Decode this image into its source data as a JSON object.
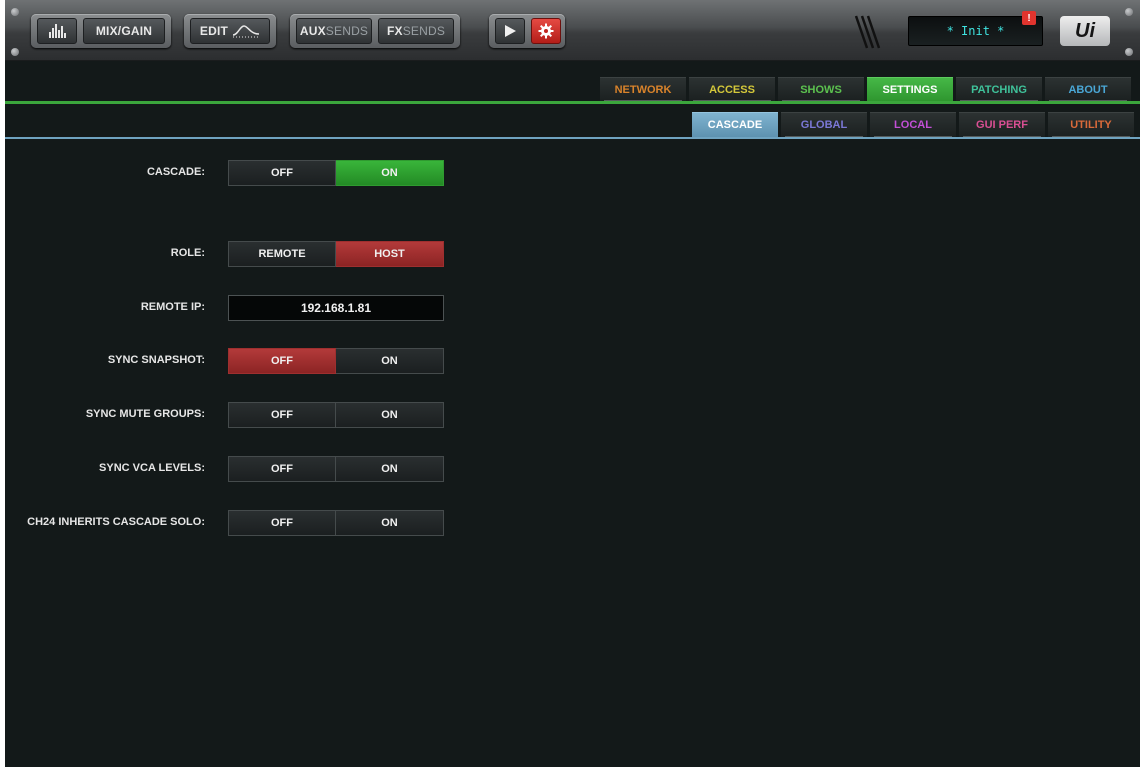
{
  "toolbar": {
    "mix_gain_label": "MIX/GAIN",
    "edit_label": "EDIT",
    "aux_prefix": "AUX",
    "aux_suffix": "SENDS",
    "fx_prefix": "FX",
    "fx_suffix": "SENDS",
    "display_text": "* Init *",
    "alert_badge": "!",
    "logo_text": "Ui",
    "icons": [
      "meters-icon",
      "eq-curve-icon",
      "play-icon",
      "gear-icon"
    ]
  },
  "main_tabs": [
    {
      "label": "NETWORK",
      "color": "#d9832b",
      "active": false
    },
    {
      "label": "ACCESS",
      "color": "#d4c83a",
      "active": false
    },
    {
      "label": "SHOWS",
      "color": "#5cc24f",
      "active": false
    },
    {
      "label": "SETTINGS",
      "color": "#ffffff",
      "bg": "#3ba63c",
      "active": true
    },
    {
      "label": "PATCHING",
      "color": "#3fc29a",
      "active": false
    },
    {
      "label": "ABOUT",
      "color": "#4aa7d6",
      "active": false
    }
  ],
  "sub_tabs": [
    {
      "label": "CASCADE",
      "color": "#ffffff",
      "bg": "#6fa3c0",
      "active": true
    },
    {
      "label": "GLOBAL",
      "color": "#7b78d6",
      "active": false
    },
    {
      "label": "LOCAL",
      "color": "#c24fd6",
      "active": false
    },
    {
      "label": "GUI PERF",
      "color": "#d94f93",
      "active": false
    },
    {
      "label": "UTILITY",
      "color": "#d96a3a",
      "active": false
    }
  ],
  "settings": {
    "cascade": {
      "label": "CASCADE:",
      "left": "OFF",
      "right": "ON",
      "selected": "right",
      "color": "green"
    },
    "role": {
      "label": "ROLE:",
      "left": "REMOTE",
      "right": "HOST",
      "selected": "right",
      "color": "red"
    },
    "remote_ip": {
      "label": "REMOTE IP:",
      "value": "192.168.1.81"
    },
    "sync_snapshot": {
      "label": "SYNC SNAPSHOT:",
      "left": "OFF",
      "right": "ON",
      "selected": "left",
      "color": "red"
    },
    "sync_mute_groups": {
      "label": "SYNC MUTE GROUPS:",
      "left": "OFF",
      "right": "ON",
      "selected": "none"
    },
    "sync_vca_levels": {
      "label": "SYNC VCA LEVELS:",
      "left": "OFF",
      "right": "ON",
      "selected": "none"
    },
    "ch24_solo": {
      "label": "CH24 INHERITS CASCADE SOLO:",
      "left": "OFF",
      "right": "ON",
      "selected": "none"
    }
  }
}
